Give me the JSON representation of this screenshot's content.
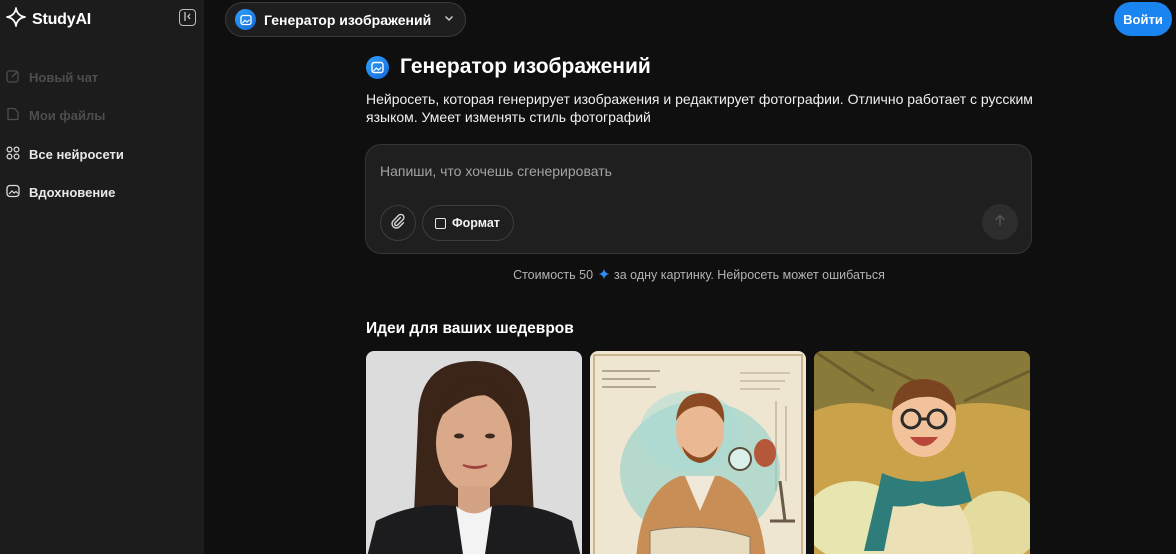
{
  "sidebar": {
    "brand": "StudyAI",
    "logo_icon": "sparkle-star-icon",
    "collapse_icon": "collapse-sidebar-icon",
    "items": [
      {
        "label": "Новый чат",
        "icon": "edit-icon",
        "state": "disabled"
      },
      {
        "label": "Мои файлы",
        "icon": "file-icon",
        "state": "disabled"
      },
      {
        "label": "Все нейросети",
        "icon": "grid-icon",
        "state": "active"
      },
      {
        "label": "Вдохновение",
        "icon": "image-icon",
        "state": "active"
      }
    ]
  },
  "header": {
    "model_name": "Генератор изображений",
    "model_icon": "image-icon",
    "login_label": "Войти"
  },
  "main": {
    "title": "Генератор изображений",
    "description": "Нейросеть, которая генерирует изображения и редактирует фотографии. Отлично работает с русским языком. Умеет изменять стиль фотографий",
    "prompt": {
      "placeholder": "Напиши, что хочешь сгенерировать",
      "value": "",
      "format_label": "Формат"
    },
    "cost": {
      "prefix": "Стоимость 50",
      "suffix": "за одну картинку. Нейросеть может ошибаться",
      "icon": "sparkle-icon"
    },
    "ideas_title": "Идеи для ваших шедевров",
    "ideas": [
      {
        "subject": "portrait-photo"
      },
      {
        "subject": "watercolor-scientist"
      },
      {
        "subject": "anime-boy"
      }
    ]
  },
  "colors": {
    "accent": "#1a84f0",
    "background": "#0f0f0f",
    "sidebar": "#1c1c1c"
  }
}
